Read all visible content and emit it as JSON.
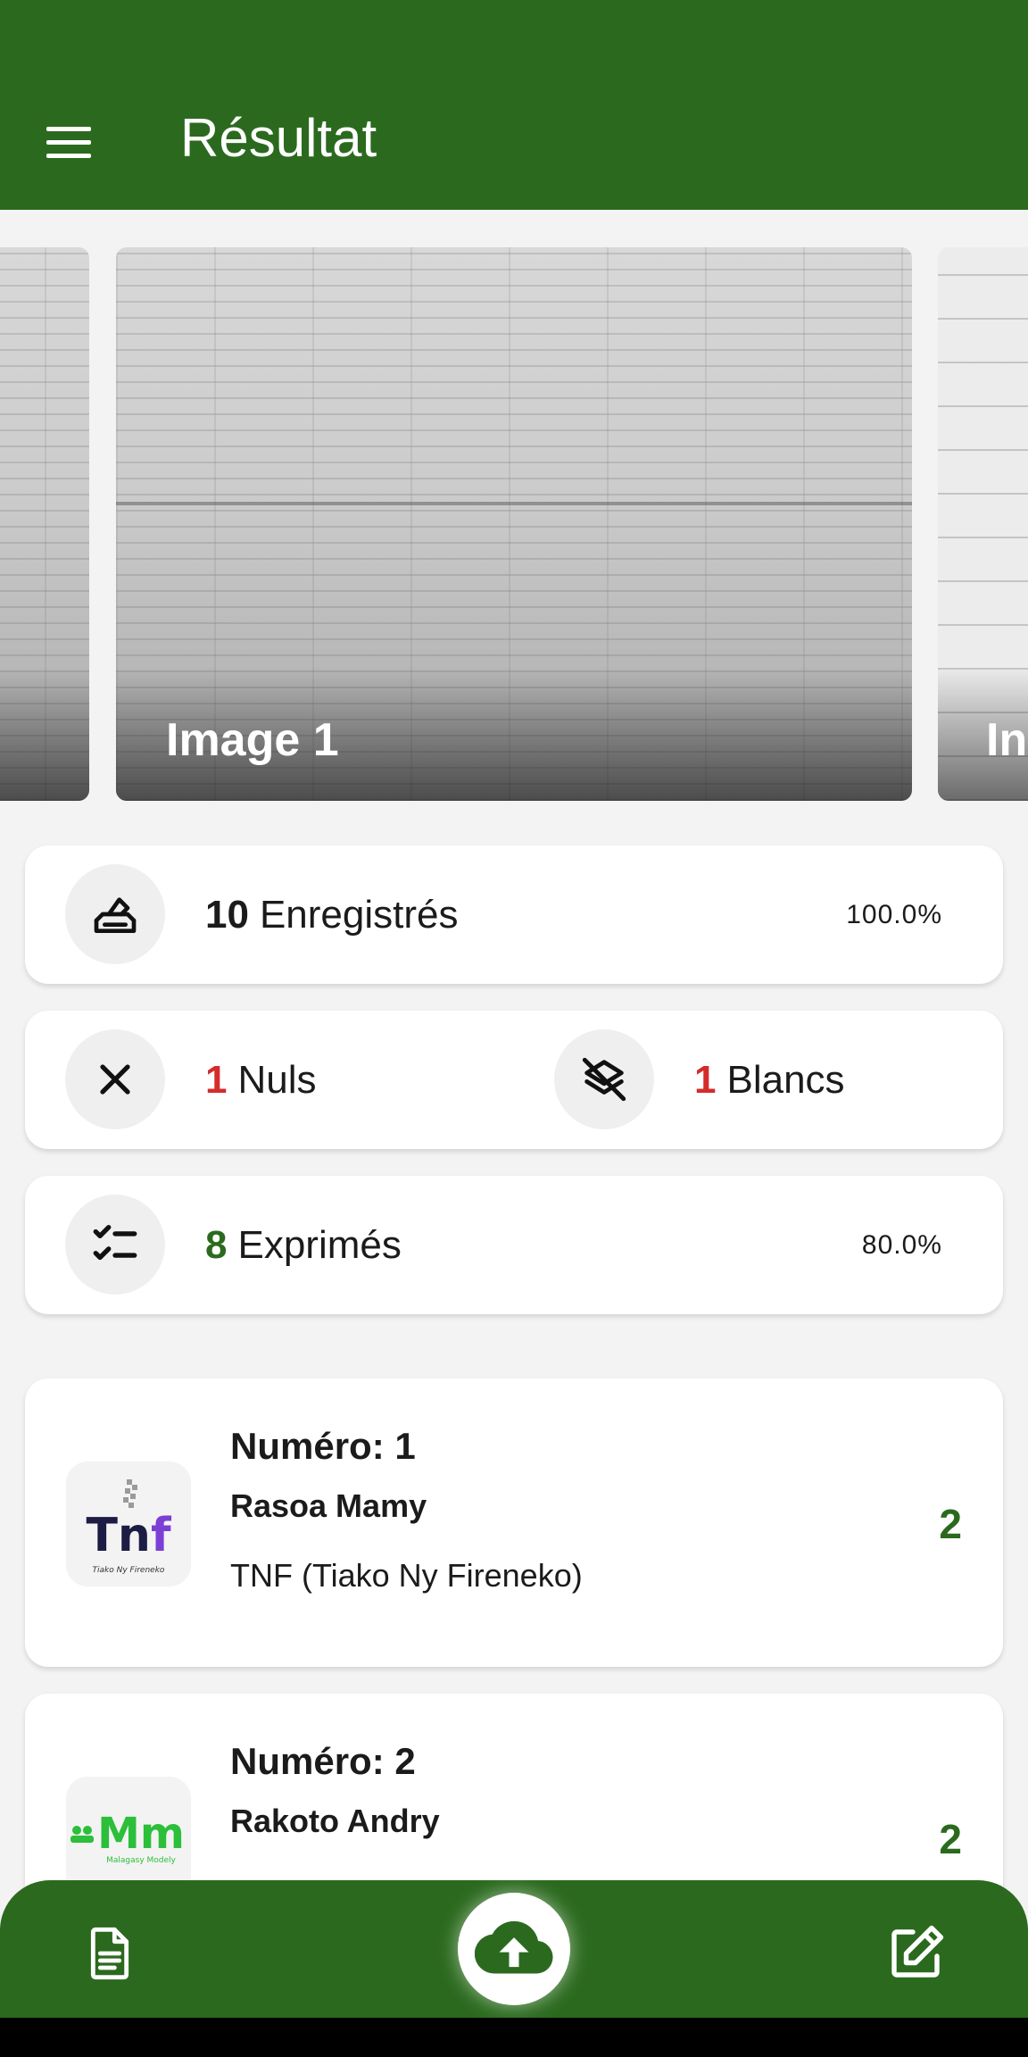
{
  "app_bar": {
    "title": "Résultat",
    "menu_icon": "menu-icon"
  },
  "carousel": {
    "slides": [
      {
        "caption": ""
      },
      {
        "caption": "Image 1"
      },
      {
        "caption": "In"
      }
    ]
  },
  "stats": {
    "registered": {
      "count": "10",
      "label": "Enregistrés",
      "percent": "100.0%",
      "icon": "ballot-box-icon"
    },
    "null_votes": {
      "count": "1",
      "label": "Nuls",
      "icon": "close-icon"
    },
    "blank_votes": {
      "count": "1",
      "label": "Blancs",
      "icon": "layers-off-icon"
    },
    "expressed": {
      "count": "8",
      "label": "Exprimés",
      "percent": "80.0%",
      "icon": "checklist-icon"
    }
  },
  "candidates": [
    {
      "number_label": "Numéro: 1",
      "name": "Rasoa Mamy",
      "party": "TNF (Tiako Ny Fireneko)",
      "votes": "2",
      "logo": {
        "text": "Tnf",
        "subtext": "Tiako Ny Fireneko"
      }
    },
    {
      "number_label": "Numéro: 2",
      "name": "Rakoto Andry",
      "party": "",
      "votes": "2",
      "logo": {
        "text": "Mm",
        "subtext": "Malagasy Modely"
      }
    }
  ],
  "bottom_nav": {
    "left_icon": "document-icon",
    "center_icon": "cloud-upload-icon",
    "right_icon": "edit-icon"
  },
  "colors": {
    "primary": "#2b6a1e",
    "accent_red": "#d42b2b",
    "background": "#f3f3f3"
  }
}
